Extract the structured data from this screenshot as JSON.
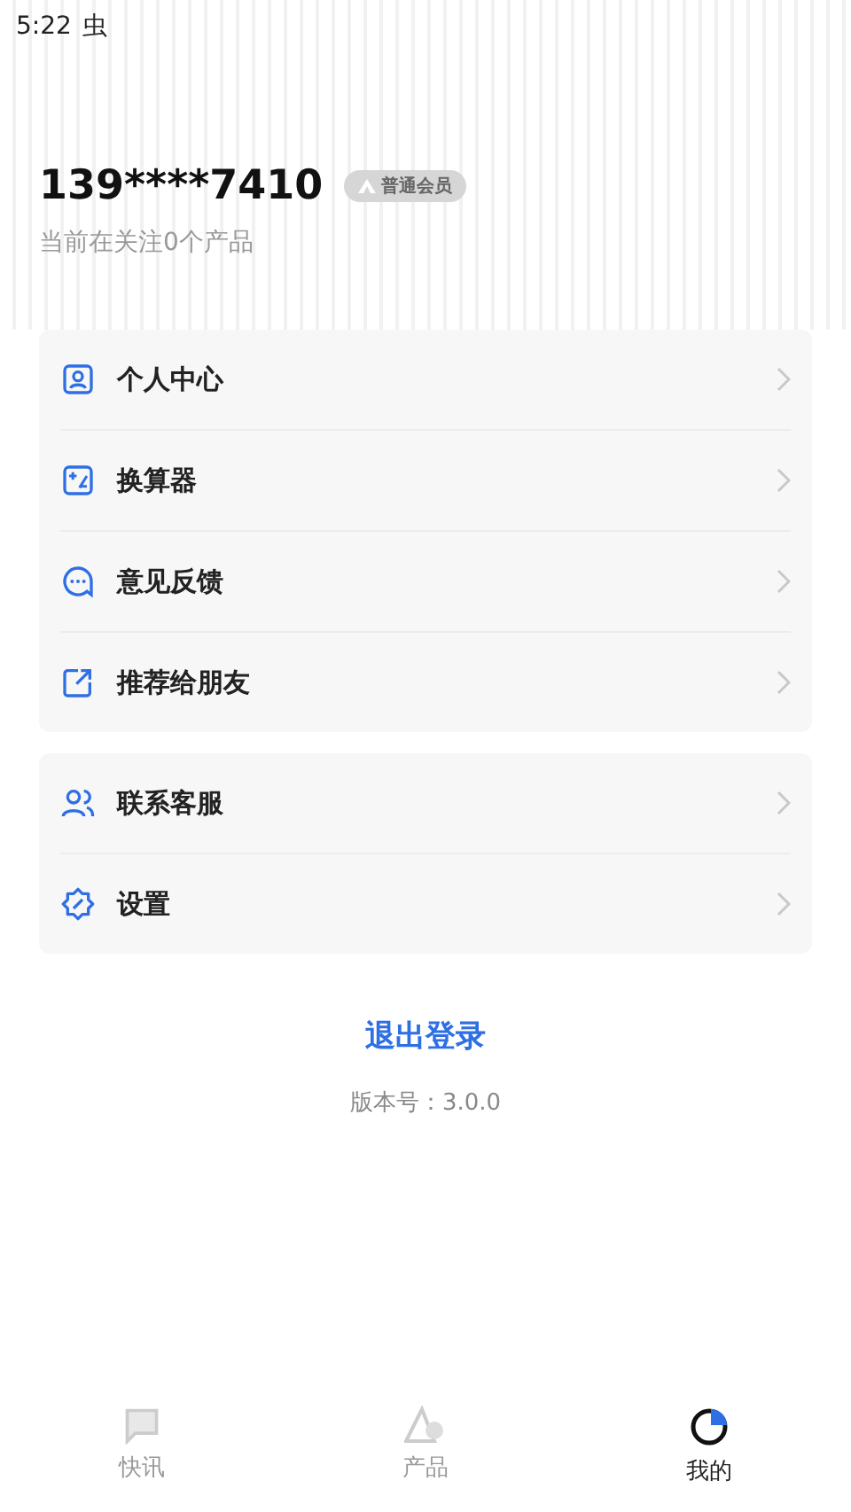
{
  "status_bar": {
    "time": "5:22",
    "icon_text": "虫"
  },
  "profile": {
    "phone": "139****7410",
    "badge": "普通会员",
    "subtitle": "当前在关注0个产品"
  },
  "menu_groups": [
    {
      "items": [
        {
          "label": "个人中心"
        },
        {
          "label": "换算器"
        },
        {
          "label": "意见反馈"
        },
        {
          "label": "推荐给朋友"
        }
      ]
    },
    {
      "items": [
        {
          "label": "联系客服"
        },
        {
          "label": "设置"
        }
      ]
    }
  ],
  "logout": "退出登录",
  "version": "版本号：3.0.0",
  "tabs": [
    {
      "label": "快讯",
      "selected": false
    },
    {
      "label": "产品",
      "selected": false
    },
    {
      "label": "我的",
      "selected": true
    }
  ]
}
